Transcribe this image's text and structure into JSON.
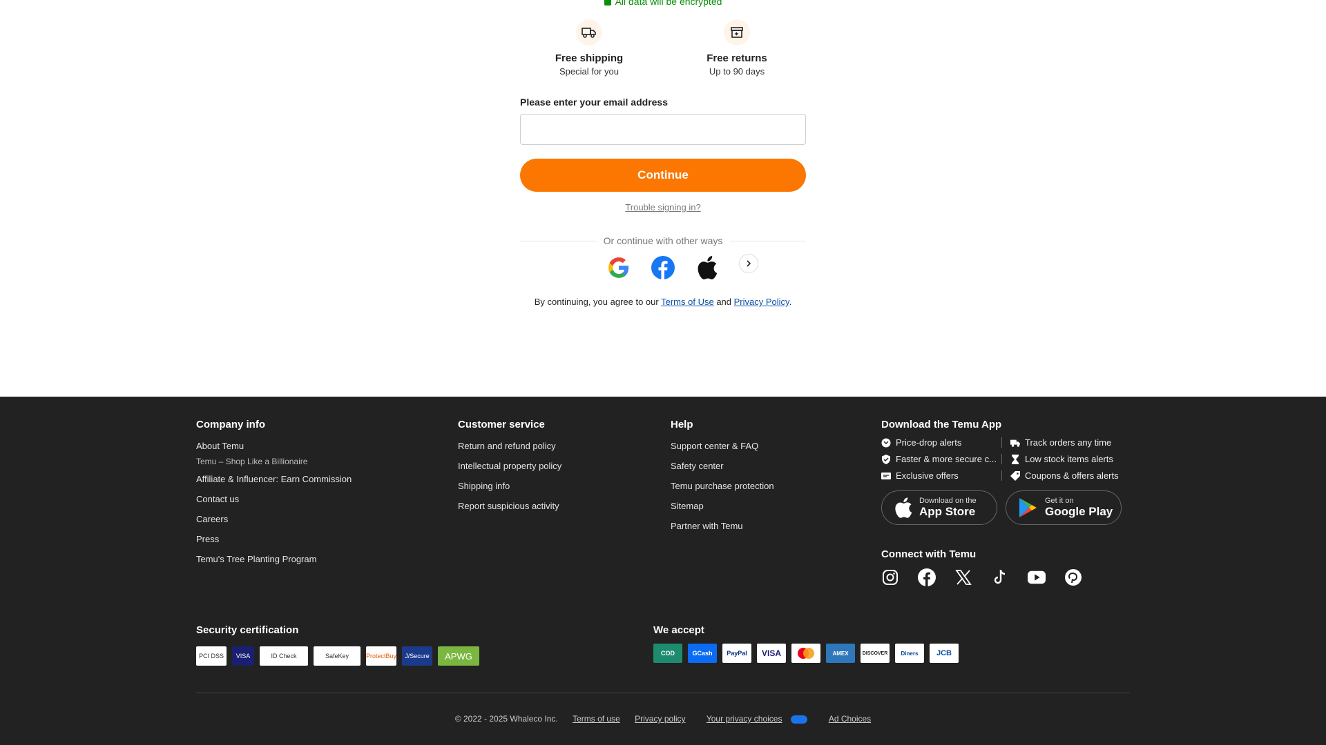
{
  "top": {
    "encrypted_text": "All data will be encrypted",
    "benefits": [
      {
        "title": "Free shipping",
        "subtitle": "Special for you",
        "icon": "truck-icon"
      },
      {
        "title": "Free returns",
        "subtitle": "Up to 90 days",
        "icon": "return-box-icon"
      }
    ],
    "email_label": "Please enter your email address",
    "email_value": "",
    "continue_label": "Continue",
    "trouble_label": "Trouble signing in?",
    "divider_text": "Or continue with other ways",
    "agree_prefix": "By continuing, you agree to our",
    "terms_label": "Terms of Use",
    "and_text": "and",
    "privacy_label": "Privacy Policy",
    "period": "."
  },
  "footer": {
    "company": {
      "heading": "Company info",
      "about": "About Temu",
      "tagline": "Temu – Shop Like a Billionaire",
      "links": [
        "Affiliate & Influencer: Earn Commission",
        "Contact us",
        "Careers",
        "Press",
        "Temu's Tree Planting Program"
      ]
    },
    "customer": {
      "heading": "Customer service",
      "links": [
        "Return and refund policy",
        "Intellectual property policy",
        "Shipping info",
        "Report suspicious activity"
      ]
    },
    "help": {
      "heading": "Help",
      "links": [
        "Support center & FAQ",
        "Safety center",
        "Temu purchase protection",
        "Sitemap",
        "Partner with Temu"
      ]
    },
    "app": {
      "heading": "Download the Temu App",
      "features": [
        "Price-drop alerts",
        "Track orders any time",
        "Faster & more secure c...",
        "Low stock items alerts",
        "Exclusive offers",
        "Coupons & offers alerts"
      ],
      "appstore_small": "Download on the",
      "appstore_large": "App Store",
      "gplay_small": "Get it on",
      "gplay_large": "Google Play",
      "connect": "Connect with Temu"
    },
    "security_heading": "Security certification",
    "accept_heading": "We accept",
    "security_badges": [
      "PCI DSS",
      "VISA",
      "ID Check",
      "SafeKey",
      "ProtectBuy",
      "J/Secure",
      "APWG"
    ],
    "cards": [
      "COD",
      "GCash",
      "PayPal",
      "VISA",
      "",
      "AMEX",
      "DISCOVER",
      "Diners",
      "JCB"
    ],
    "legal": {
      "copyright": "© 2022 - 2025 Whaleco Inc.",
      "terms": "Terms of use",
      "privacy": "Privacy policy",
      "choices": "Your privacy choices",
      "ad": "Ad Choices"
    }
  }
}
